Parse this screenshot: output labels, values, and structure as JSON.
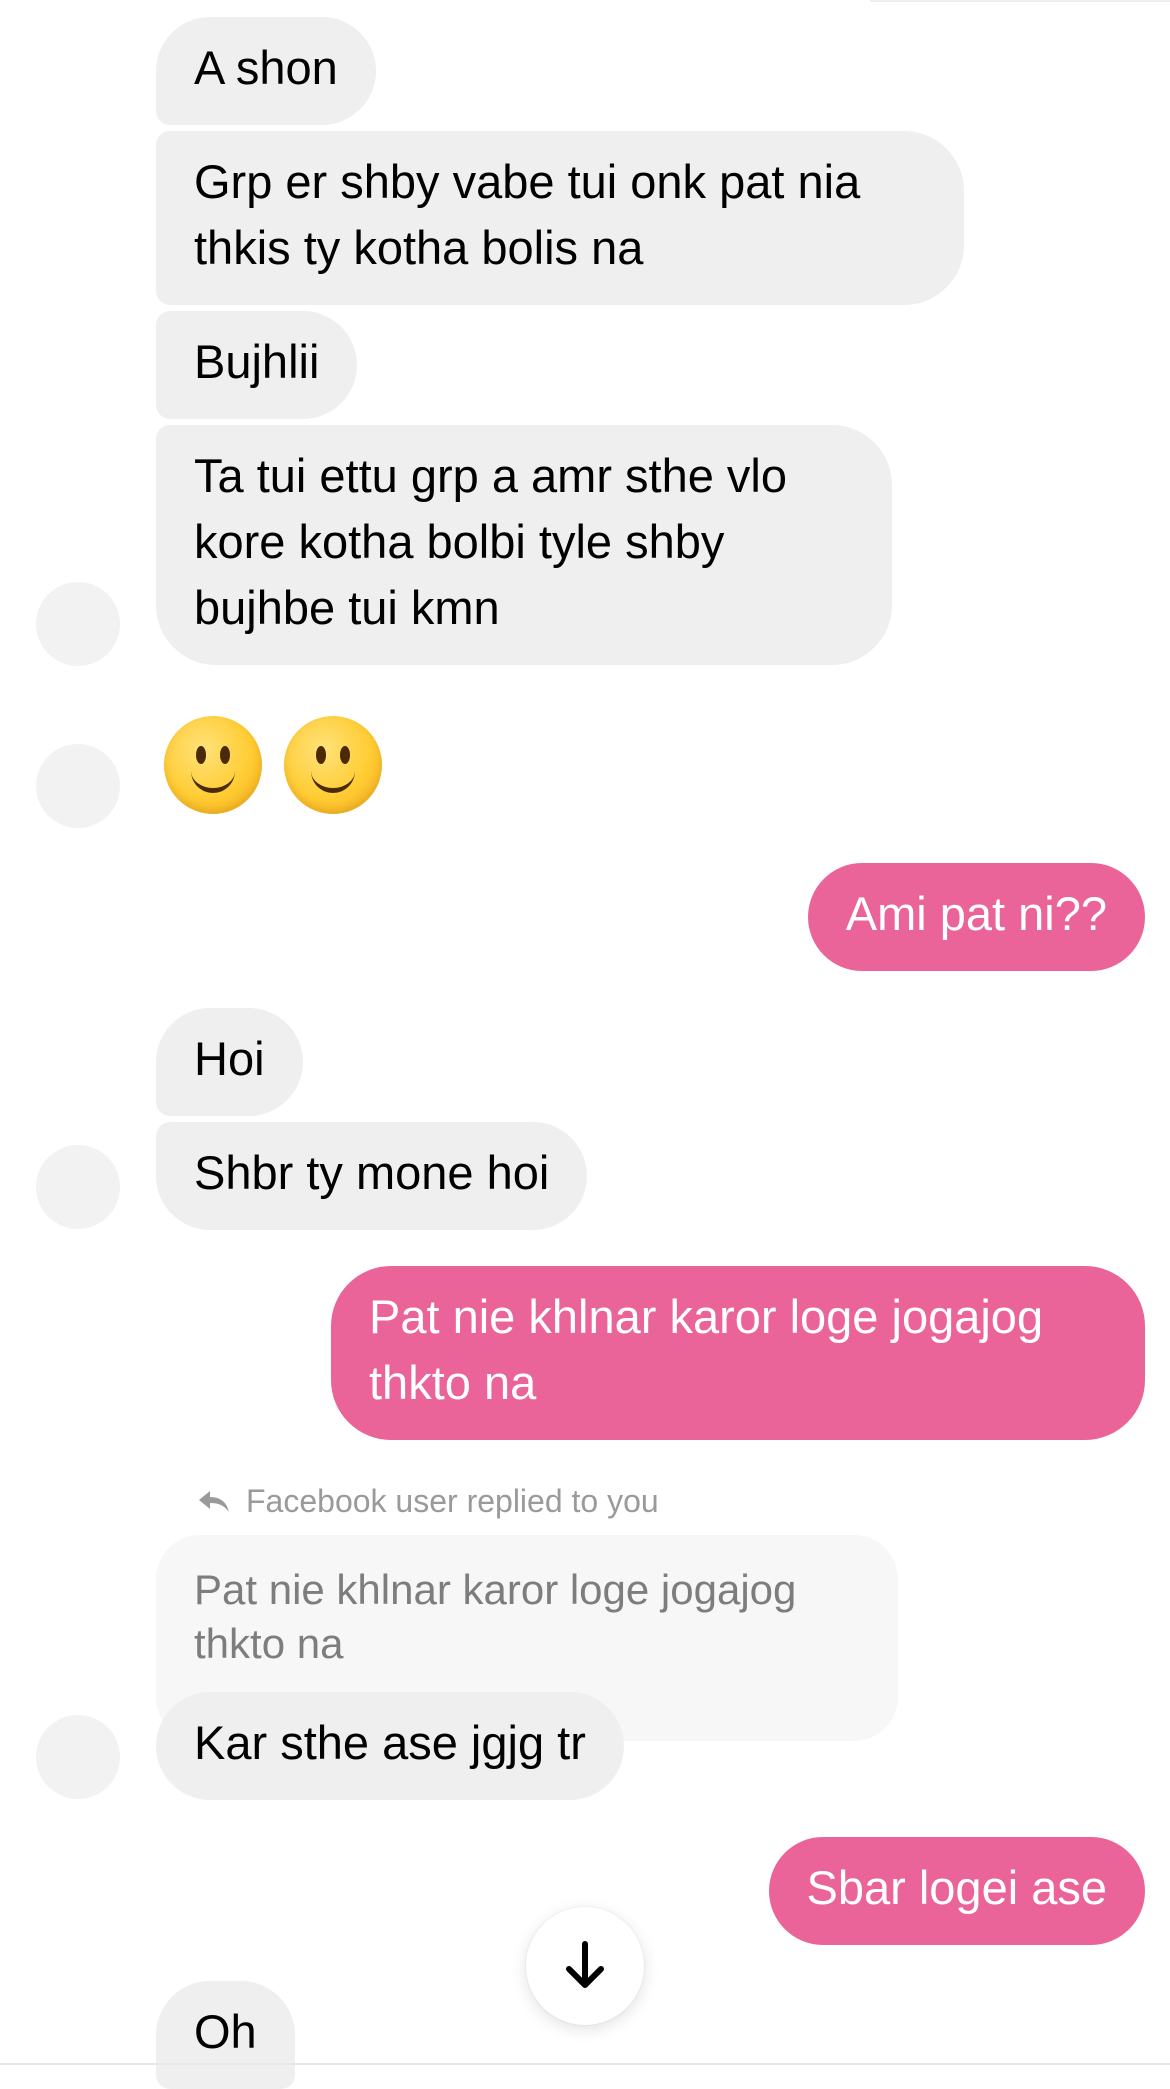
{
  "colors": {
    "incoming_bubble": "#efefef",
    "outgoing_bubble": "#ea6499",
    "quoted_bubble": "#f7f7f7",
    "reply_label": "#9a9a9a"
  },
  "messages": [
    {
      "from": "them",
      "text": "A shon"
    },
    {
      "from": "them",
      "text": "Grp er shby vabe tui onk pat nia\nthkis ty kotha bolis na"
    },
    {
      "from": "them",
      "text": "Bujhlii"
    },
    {
      "from": "them",
      "text": "Ta tui ettu grp a amr sthe vlo\nkore kotha bolbi tyle shby\nbujhbe tui kmn"
    },
    {
      "from": "them",
      "text": "",
      "emoji": [
        "slightly-smiling-face-emoji",
        "slightly-smiling-face-emoji"
      ]
    },
    {
      "from": "me",
      "text": "Ami pat ni??"
    },
    {
      "from": "them",
      "text": "Hoi"
    },
    {
      "from": "them",
      "text": "Shbr ty mone hoi"
    },
    {
      "from": "me",
      "text": "Pat nie khlnar karor loge jogajog\nthkto na"
    },
    {
      "from": "them",
      "text": "Kar sthe ase jgjg tr"
    },
    {
      "from": "me",
      "text": "Sbar logei ase"
    },
    {
      "from": "them",
      "text": "Oh"
    }
  ],
  "reply": {
    "label": "Facebook user replied to you",
    "quoted_text": "Pat nie khlnar karor loge jogajog\nthkto na",
    "icon": "reply-arrow-icon"
  },
  "scroll_button": {
    "icon": "arrow-down-icon"
  }
}
